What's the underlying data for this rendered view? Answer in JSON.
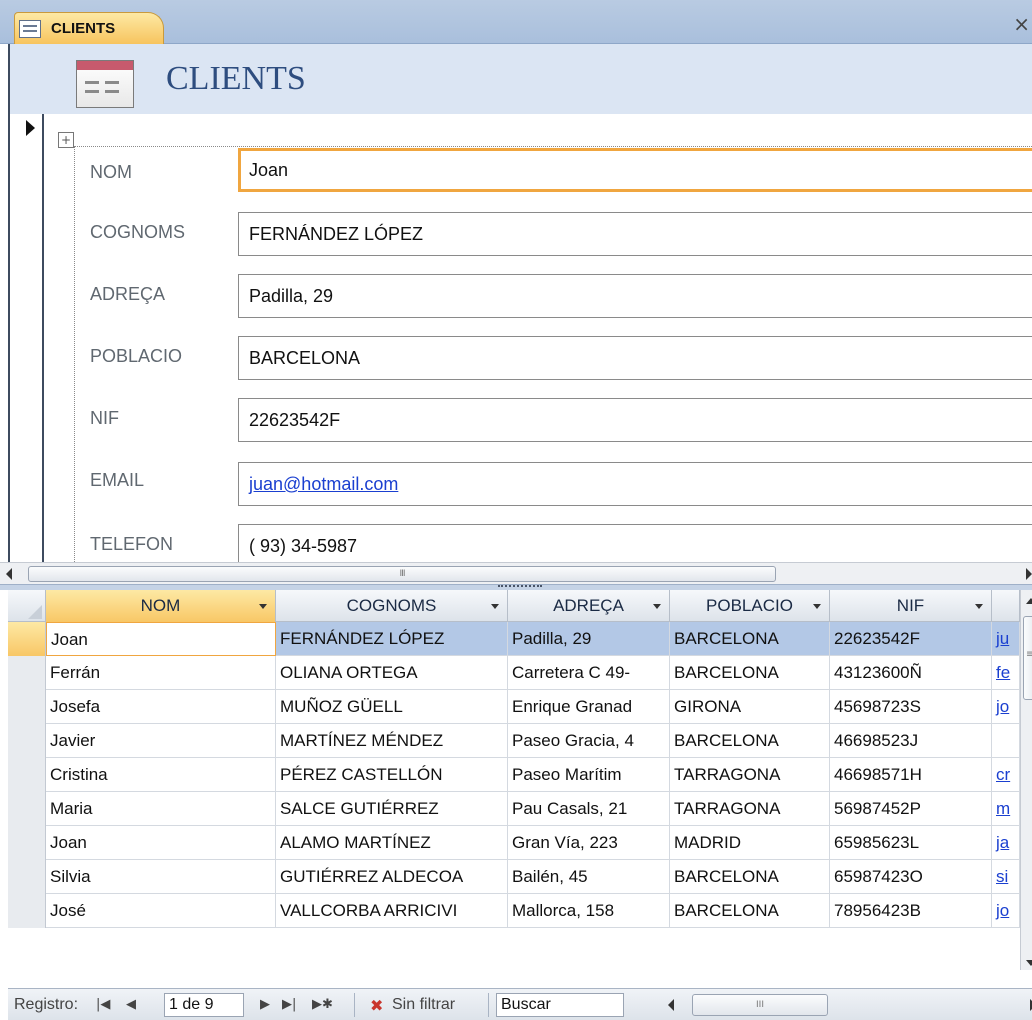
{
  "window": {
    "tab_label": "CLIENTS",
    "close_glyph": "×"
  },
  "form": {
    "title": "CLIENTS",
    "fields": [
      {
        "label": "NOM",
        "value": "Joan"
      },
      {
        "label": "COGNOMS",
        "value": "FERNÁNDEZ LÓPEZ"
      },
      {
        "label": "ADREÇA",
        "value": "Padilla, 29"
      },
      {
        "label": "POBLACIO",
        "value": "BARCELONA"
      },
      {
        "label": "NIF",
        "value": "22623542F"
      },
      {
        "label": "EMAIL",
        "value": "juan@hotmail.com"
      },
      {
        "label": "TELEFON",
        "value": "( 93) 34-5987"
      }
    ]
  },
  "datasheet": {
    "columns": [
      "NOM",
      "COGNOMS",
      "ADREÇA",
      "POBLACIO",
      "NIF"
    ],
    "rows": [
      [
        "Joan",
        "FERNÁNDEZ LÓPEZ",
        "Padilla, 29",
        "BARCELONA",
        "22623542F",
        "ju"
      ],
      [
        "Ferrán",
        "OLIANA ORTEGA",
        "Carretera C 49-",
        "BARCELONA",
        "43123600Ñ",
        "fe"
      ],
      [
        "Josefa",
        "MUÑOZ GÜELL",
        "Enrique Granad",
        "GIRONA",
        "45698723S",
        "jo"
      ],
      [
        "Javier",
        "MARTÍNEZ MÉNDEZ",
        "Paseo Gracia, 4",
        "BARCELONA",
        "46698523J",
        ""
      ],
      [
        "Cristina",
        "PÉREZ CASTELLÓN",
        "Paseo Marítim",
        "TARRAGONA",
        "46698571H",
        "cr"
      ],
      [
        "Maria",
        "SALCE GUTIÉRREZ",
        "Pau Casals, 21",
        "TARRAGONA",
        "56987452P",
        "m"
      ],
      [
        "Joan",
        "ALAMO MARTÍNEZ",
        "Gran Vía, 223",
        "MADRID",
        "65985623L",
        "ja"
      ],
      [
        "Silvia",
        "GUTIÉRREZ ALDECOA",
        "Bailén, 45",
        "BARCELONA",
        "65987423O",
        "si"
      ],
      [
        "José",
        "VALLCORBA ARRICIVI",
        "Mallorca, 158",
        "BARCELONA",
        "78956423B",
        "jo"
      ]
    ]
  },
  "navigation": {
    "label": "Registro:",
    "current": "1 de 9",
    "filter": "Sin filtrar",
    "search": "Buscar",
    "btn_first": "|◀",
    "btn_prev": "◀",
    "btn_next": "▶",
    "btn_last": "▶|",
    "btn_new": "▶✱"
  },
  "colors": {
    "accent": "#f0a640",
    "header_band": "#dbe5f3",
    "selected_row": "#b3c8e6",
    "title": "#2e4d7f"
  }
}
